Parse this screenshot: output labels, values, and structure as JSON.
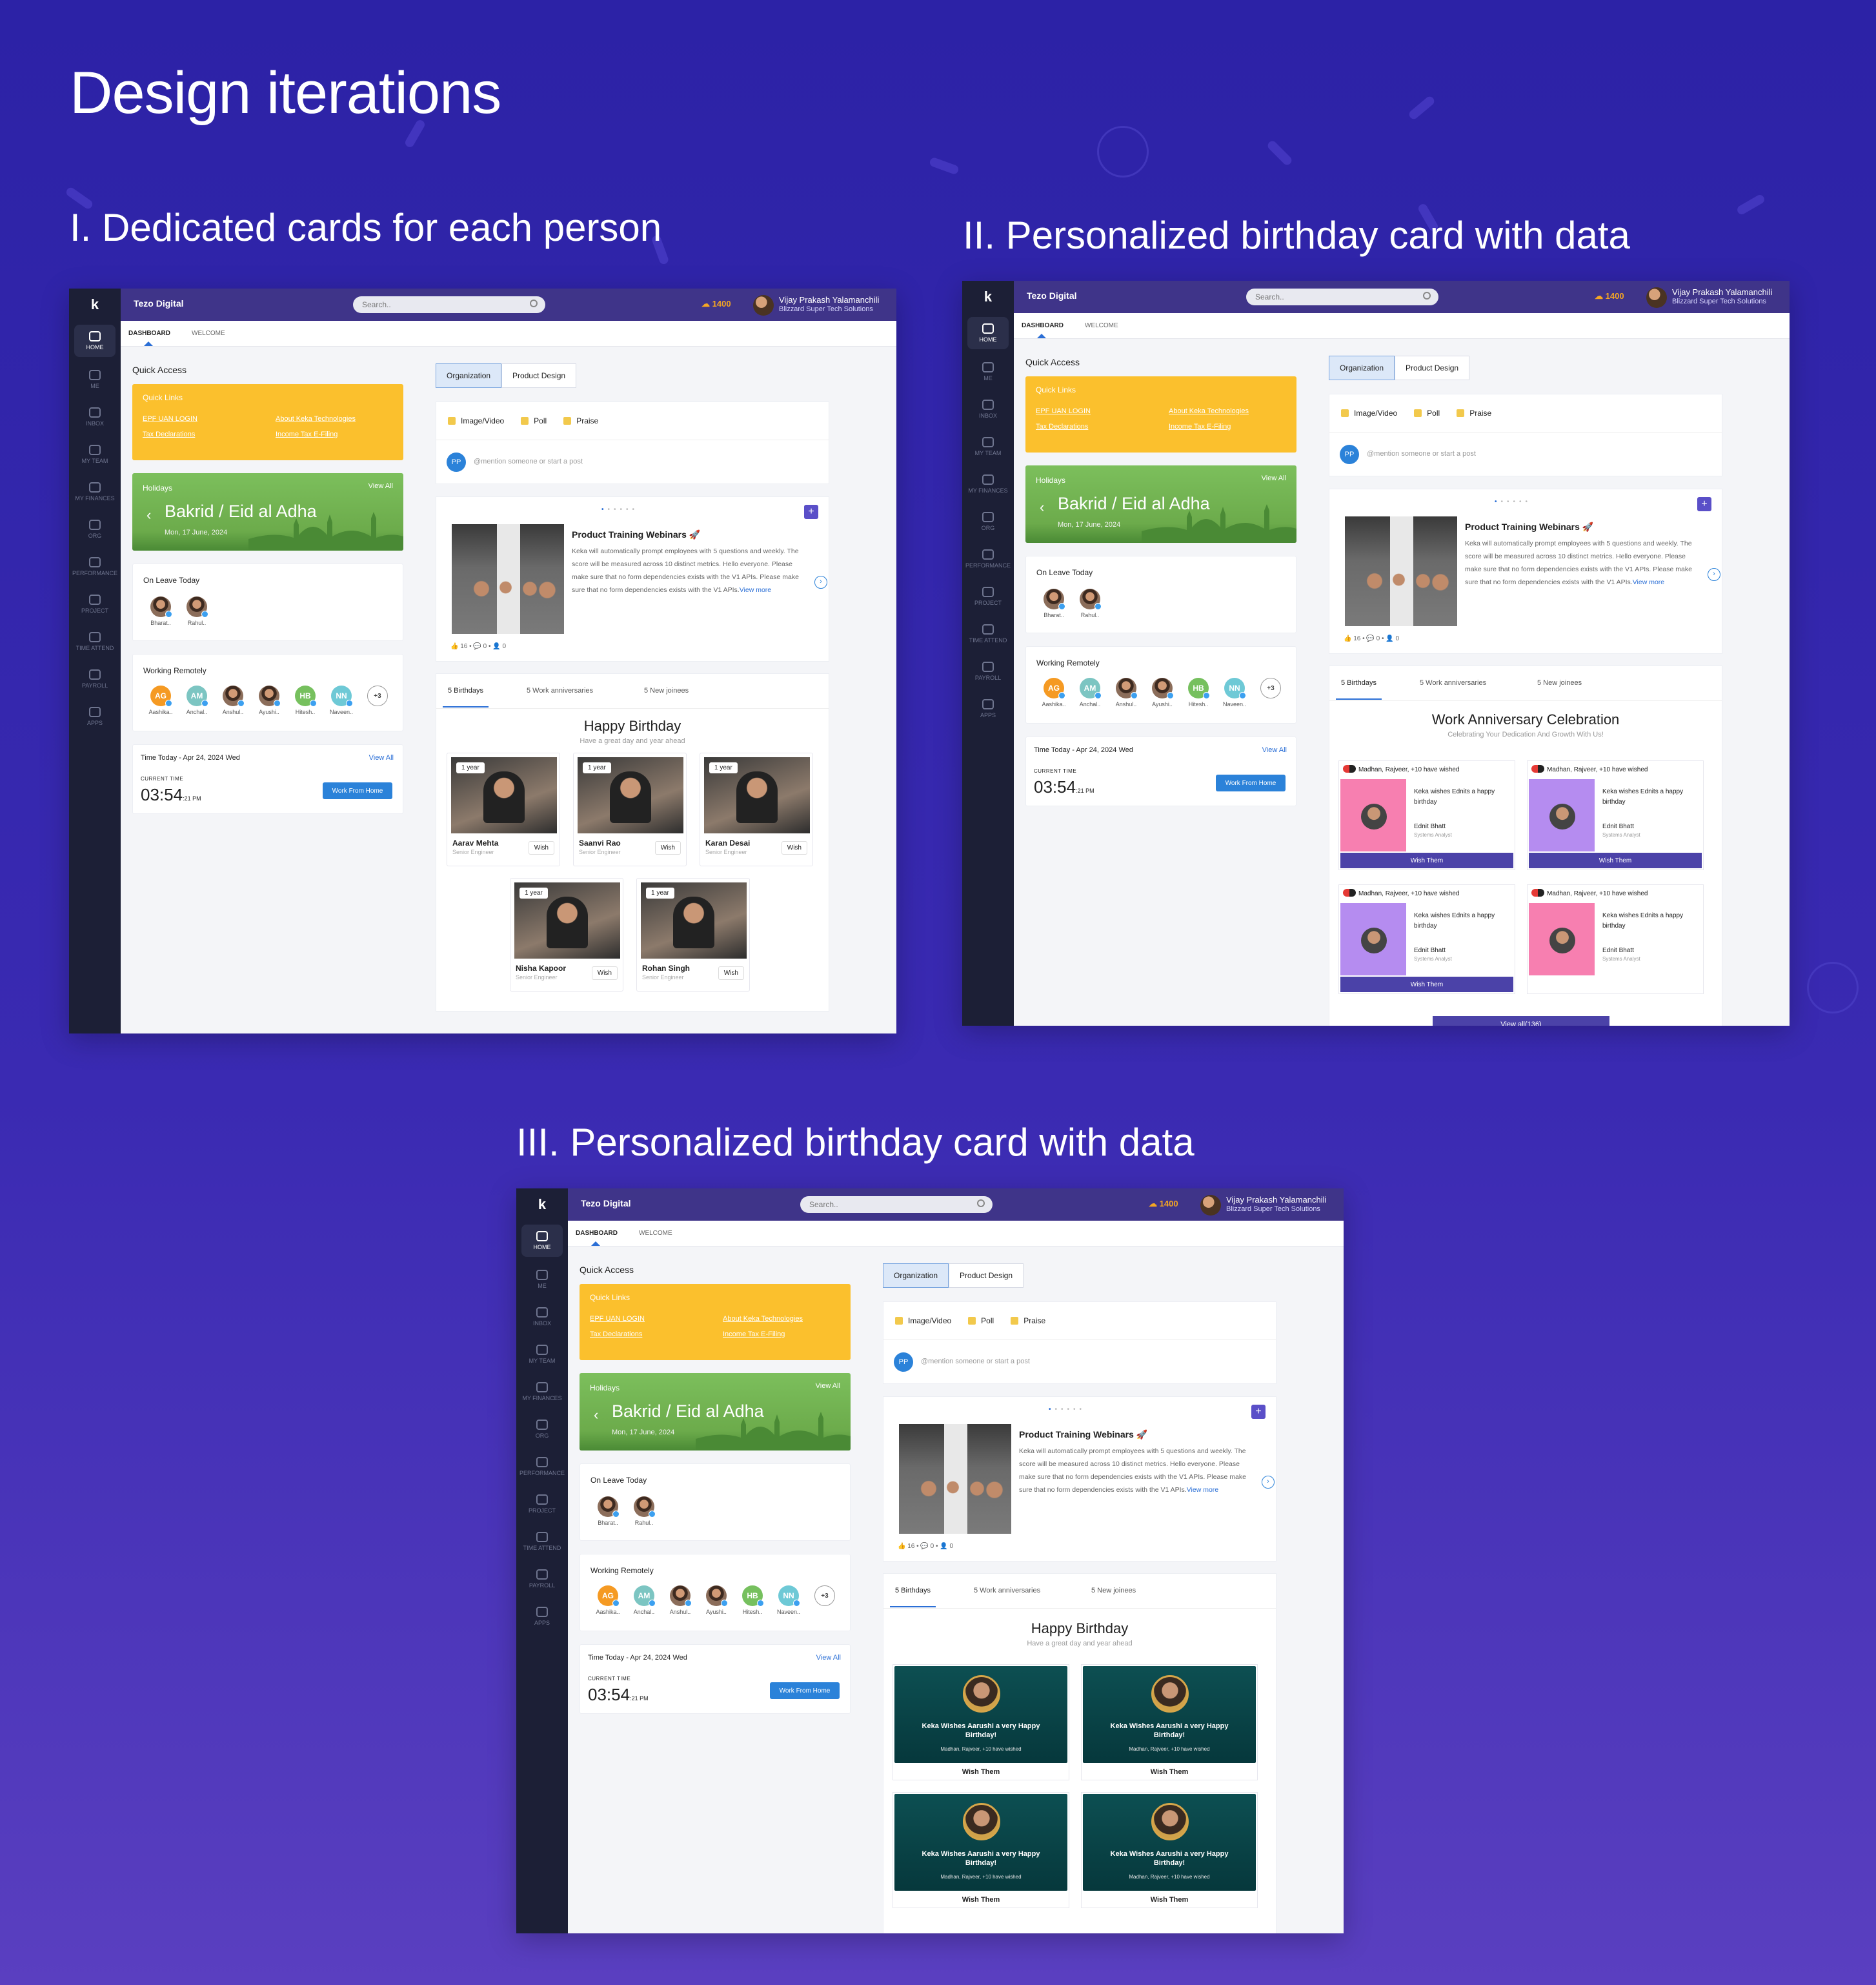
{
  "page": {
    "title": "Design iterations",
    "sections": [
      "I. Dedicated cards for each person",
      "II. Personalized birthday card with data",
      "III. Personalized birthday card with data"
    ]
  },
  "common": {
    "logo": "k",
    "org": "Tezo Digital",
    "search_placeholder": "Search..",
    "coins": "1400",
    "user_name": "Vijay Prakash Yalamanchili",
    "user_company": "Blizzard Super Tech Solutions",
    "nav": [
      "HOME",
      "ME",
      "INBOX",
      "MY TEAM",
      "MY FINANCES",
      "ORG",
      "PERFORMANCE",
      "PROJECT",
      "TIME ATTEND",
      "PAYROLL",
      "APPS"
    ],
    "tabs": {
      "dashboard": "DASHBOARD",
      "welcome": "WELCOME"
    },
    "quick_access": "Quick Access",
    "quick_links": {
      "title": "Quick Links",
      "links": [
        "EPF UAN LOGIN",
        "Tax Declarations",
        "About Keka Technologies",
        "Income Tax E-Filing"
      ]
    },
    "holidays": {
      "title": "Holidays",
      "view_all": "View All",
      "name": "Bakrid / Eid al Adha",
      "date": "Mon, 17 June, 2024"
    },
    "on_leave": {
      "title": "On Leave Today",
      "people": [
        "Bharat..",
        "Rahul.."
      ]
    },
    "remote": {
      "title": "Working Remotely",
      "people": [
        {
          "initials": "AG",
          "name": "Aashika..",
          "color": "#f59a23"
        },
        {
          "initials": "AM",
          "name": "Anchal..",
          "color": "#7cc5c2"
        },
        {
          "initials": "",
          "name": "Anshul..",
          "color": "#c9a07e"
        },
        {
          "initials": "",
          "name": "Ayushi..",
          "color": "#b58b5a"
        },
        {
          "initials": "HB",
          "name": "Hitesh..",
          "color": "#76c05e"
        },
        {
          "initials": "NN",
          "name": "Naveen..",
          "color": "#6ec9d6"
        }
      ],
      "more": "+3"
    },
    "time": {
      "title": "Time Today - Apr 24, 2024 Wed",
      "view_all": "View All",
      "label": "CURRENT TIME",
      "value": "03:54",
      "sec": ":21 PM",
      "wfh": "Work From Home"
    },
    "seg": [
      "Organization",
      "Product Design"
    ],
    "post": {
      "actions": [
        "Image/Video",
        "Poll",
        "Praise"
      ],
      "avatar": "PP",
      "placeholder": "@mention someone or start a post"
    },
    "announcement": {
      "title": "Product Training Webinars 🚀",
      "body": "Keka will automatically prompt employees with 5 questions and weekly. The score will be measured across 10 distinct metrics. Hello everyone. Please make sure that no form dependencies exists with the V1 APIs. Please make sure that no form dependencies exists with the V1 APIs.",
      "view_more": "View more",
      "stats": "👍 16  •  💬 0  •  👤 0"
    },
    "cel_tabs": [
      "5 Birthdays",
      "5 Work anniversaries",
      "5 New joinees"
    ]
  },
  "v1": {
    "heading": "Happy Birthday",
    "sub": "Have a great day and year ahead",
    "people": [
      {
        "year": "1 year",
        "name": "Aarav Mehta",
        "role": "Senior Engineer",
        "wish": "Wish"
      },
      {
        "year": "1 year",
        "name": "Saanvi Rao",
        "role": "Senior Engineer",
        "wish": "Wish"
      },
      {
        "year": "1 year",
        "name": "Karan Desai",
        "role": "Senior Engineer",
        "wish": "Wish"
      },
      {
        "year": "1 year",
        "name": "Nisha Kapoor",
        "role": "Senior Engineer",
        "wish": "Wish"
      },
      {
        "year": "1 year",
        "name": "Rohan Singh",
        "role": "Senior Engineer",
        "wish": "Wish"
      }
    ]
  },
  "v2": {
    "heading": "Work Anniversary Celebration",
    "sub": "Celebrating Your Dedication And Growth With Us!",
    "cards": [
      {
        "wished": "Madhan, Rajveer, +10 have wished",
        "text": "Keka wishes Ednits a happy birthday",
        "name": "Ednit Bhatt",
        "role": "Systems Analyst",
        "btn": "Wish Them",
        "color": "#f77fb0"
      },
      {
        "wished": "Madhan, Rajveer, +10 have wished",
        "text": "Keka wishes Ednits a happy birthday",
        "name": "Ednit Bhatt",
        "role": "Systems Analyst",
        "btn": "Wish Them",
        "color": "#b58cf0"
      },
      {
        "wished": "Madhan, Rajveer, +10 have wished",
        "text": "Keka wishes Ednits a happy birthday",
        "name": "Ednit Bhatt",
        "role": "Systems Analyst",
        "btn": "Wish Them",
        "color": "#b58cf0"
      },
      {
        "wished": "Madhan, Rajveer, +10 have wished",
        "text": "Keka wishes Ednits a happy birthday",
        "name": "Ednit Bhatt",
        "role": "Systems Analyst",
        "btn": "",
        "color": "#f77fb0"
      }
    ],
    "view_all": "View all(136)"
  },
  "v3": {
    "heading": "Happy Birthday",
    "sub": "Have a great day and year ahead",
    "cards": [
      {
        "msg": "Keka Wishes Aarushi a very Happy Birthday!",
        "wished": "Madhan, Rajveer, +10 have wished",
        "btn": "Wish Them"
      },
      {
        "msg": "Keka Wishes Aarushi a very Happy Birthday!",
        "wished": "Madhan, Rajveer, +10 have wished",
        "btn": "Wish Them"
      },
      {
        "msg": "Keka Wishes Aarushi a very Happy Birthday!",
        "wished": "Madhan, Rajveer, +10 have wished",
        "btn": "Wish Them"
      },
      {
        "msg": "Keka Wishes Aarushi a very Happy Birthday!",
        "wished": "Madhan, Rajveer, +10 have wished",
        "btn": "Wish Them"
      }
    ]
  }
}
